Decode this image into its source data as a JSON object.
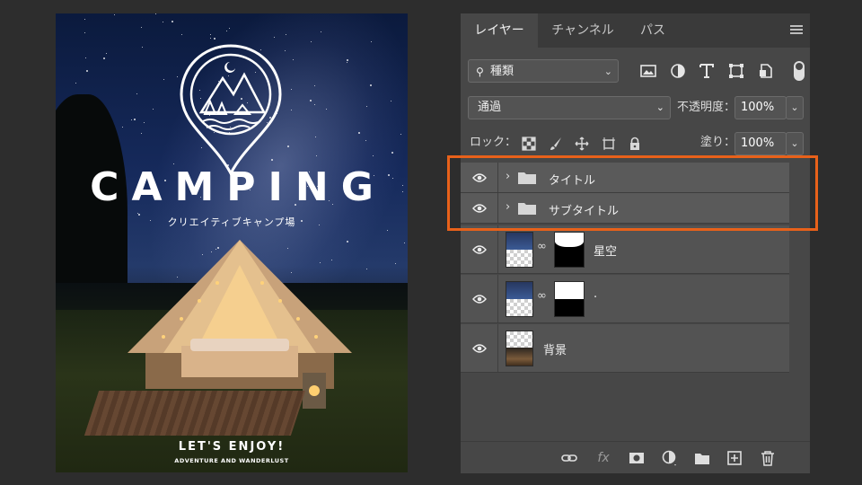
{
  "poster": {
    "title": "CAMPING",
    "subtitle": "クリエイティブキャンプ場",
    "tagline": "LET'S ENJOY!",
    "tagline_sub": "ADVENTURE AND WANDERLUST"
  },
  "panel": {
    "tabs": [
      {
        "label": "レイヤー",
        "active": true
      },
      {
        "label": "チャンネル",
        "active": false
      },
      {
        "label": "パス",
        "active": false
      }
    ],
    "filter": {
      "label": "種類",
      "icons": [
        "image-filter-icon",
        "adjustment-filter-icon",
        "type-filter-icon",
        "shape-filter-icon",
        "smart-object-filter-icon"
      ]
    },
    "blend_mode": "通過",
    "opacity_label": "不透明度：",
    "opacity_value": "100%",
    "lock_label": "ロック：",
    "fill_label": "塗り：",
    "fill_value": "100%",
    "layers": [
      {
        "name": "タイトル",
        "type": "group",
        "visible": true
      },
      {
        "name": "サブタイトル",
        "type": "group",
        "visible": true
      },
      {
        "name": "星空",
        "type": "smart-with-mask",
        "visible": true
      },
      {
        "name": ".",
        "type": "smart-with-mask",
        "visible": true
      },
      {
        "name": "背景",
        "type": "image",
        "visible": true
      }
    ],
    "bottom_icons": [
      "link-layers-icon",
      "fx-icon",
      "add-mask-icon",
      "adjustment-layer-icon",
      "new-group-icon",
      "new-layer-icon",
      "trash-icon"
    ]
  },
  "colors": {
    "highlight": "#e8611a",
    "panel_bg": "#474747",
    "app_bg": "#2d2d2d"
  }
}
